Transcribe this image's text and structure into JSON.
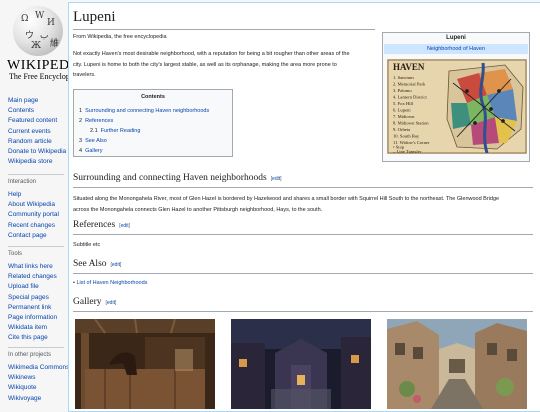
{
  "logo": {
    "wordmark": "WIKIPEDIA",
    "tagline": "The Free Encyclopedia"
  },
  "sidebar": {
    "main": [
      "Main page",
      "Contents",
      "Featured content",
      "Current events",
      "Random article",
      "Donate to Wikipedia",
      "Wikipedia store"
    ],
    "interaction_head": "Interaction",
    "interaction": [
      "Help",
      "About Wikipedia",
      "Community portal",
      "Recent changes",
      "Contact page"
    ],
    "tools_head": "Tools",
    "tools": [
      "What links here",
      "Related changes",
      "Upload file",
      "Special pages",
      "Permanent link",
      "Page information",
      "Wikidata item",
      "Cite this page"
    ],
    "projects_head": "In other projects",
    "projects": [
      "Wikimedia Commons",
      "Wikinews",
      "Wikiquote",
      "Wikivoyage"
    ]
  },
  "article": {
    "title": "Lupeni",
    "from": "From Wikipedia, the free encyclopedia",
    "intro_l1": "Not exactly Haven's most desirable neighborhood, with a reputation for being a bit rougher than other areas of the",
    "intro_l2": "city. Lupeni is home to both the city's largest stable, as well as its orphanage, making the area more prone to",
    "intro_l3": "travelers."
  },
  "toc": {
    "title": "Contents",
    "items": [
      {
        "num": "1",
        "label": "Surrounding and connecting Haven neighborhoods"
      },
      {
        "num": "2",
        "label": "References"
      },
      {
        "num": "2.1",
        "label": "Further Reading"
      },
      {
        "num": "3",
        "label": "See Also"
      },
      {
        "num": "4",
        "label": "Gallery"
      }
    ]
  },
  "infobox": {
    "title": "Lupeni",
    "band": "Neighborhood of Haven",
    "map_title": "HAVEN",
    "map_legend": [
      "1. Sanctum",
      "2. Memorial Park",
      "3. Palomo",
      "4. Lantern District",
      "5. Fox Hill",
      "6. Lupeni",
      "7. Midtown",
      "8. Midtown Station",
      "9. Orheta",
      "10. South Bay",
      "11. Widow's Corner",
      "• Stop",
      "– Line Transfer"
    ]
  },
  "sections": {
    "edit_open": "[",
    "edit_label": "edit",
    "edit_close": "]",
    "surrounding_title": "Surrounding and connecting Haven neighborhoods",
    "surrounding_l1": "Situated along the Monongahela River, most of Glen Hazel is bordered by Hazelwood and shares a small border with Squirrel Hill South to the northeast. The Glenwood Bridge",
    "surrounding_l2": "across the Monongahela connects Glen Hazel to another Pittsburgh neighborhood, Hays, to the south.",
    "references_title": "References",
    "references_text": "Subtitle etc",
    "seealso_title": "See Also",
    "seealso_item": "List of Haven Neighborhoods",
    "gallery_title": "Gallery"
  },
  "gallery": [
    "stable-photo",
    "night-street-photo",
    "old-street-photo"
  ]
}
